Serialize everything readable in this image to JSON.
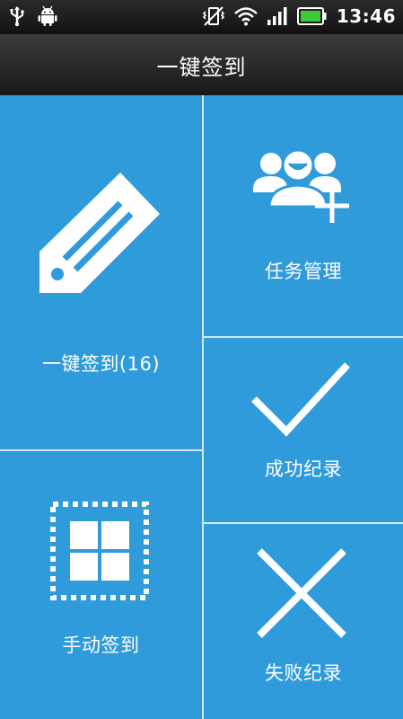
{
  "status_bar": {
    "time": "13:46",
    "icons": [
      "usb-icon",
      "android-debug-icon",
      "vibrate-icon",
      "wifi-icon",
      "signal-icon",
      "battery-icon"
    ]
  },
  "title_bar": {
    "title": "一键签到"
  },
  "tiles": {
    "one_key_checkin": {
      "label": "一键签到(16)",
      "icon": "tag-icon"
    },
    "task_management": {
      "label": "任务管理",
      "icon": "add-users-icon"
    },
    "success_record": {
      "label": "成功纪录",
      "icon": "checkmark-icon"
    },
    "manual_checkin": {
      "label": "手动签到",
      "icon": "grid-select-icon"
    },
    "failure_record": {
      "label": "失败纪录",
      "icon": "cross-icon"
    }
  },
  "colors": {
    "tile_background": "#2f9bdb",
    "icon_color": "#ffffff",
    "divider": "#cfe7f6"
  }
}
